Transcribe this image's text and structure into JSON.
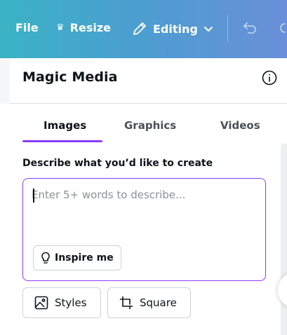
{
  "toolbar": {
    "file_label": "File",
    "resize_label": "Resize",
    "editing_label": "Editing"
  },
  "panel": {
    "title": "Magic Media",
    "tabs": [
      {
        "label": "Images",
        "active": true
      },
      {
        "label": "Graphics",
        "active": false
      },
      {
        "label": "Videos",
        "active": false
      }
    ],
    "describe_label": "Describe what you’d like to create",
    "prompt": {
      "value": "",
      "placeholder": "Enter 5+ words to describe..."
    },
    "inspire_label": "Inspire me",
    "styles_label": "Styles",
    "aspect_label": "Square"
  },
  "icons": {
    "resize": "crown-icon",
    "editing": "pencil-icon",
    "editing_menu": "chevron-down-icon",
    "undo": "undo-icon",
    "redo": "redo-icon",
    "info": "info-icon",
    "inspire": "lightbulb-icon",
    "styles": "image-icon",
    "aspect": "crop-icon"
  },
  "colors": {
    "accent": "#8b3dff",
    "toolbar_start": "#3bb3c5",
    "toolbar_end": "#6a8fd8"
  }
}
